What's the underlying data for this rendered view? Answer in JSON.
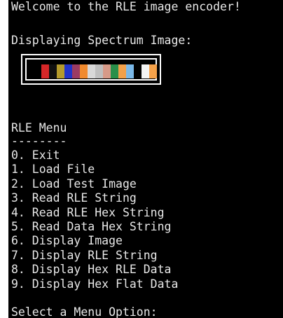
{
  "terminal": {
    "welcome": "Welcome to the RLE image encoder!",
    "displaying": "Displaying Spectrum Image:",
    "menu_title": "RLE Menu",
    "menu_rule": "--------",
    "menu_items": [
      "0. Exit",
      "1. Load File",
      "2. Load Test Image",
      "3. Read RLE String",
      "4. Read RLE Hex String",
      "5. Read Data Hex String",
      "6. Display Image",
      "7. Display RLE String",
      "8. Display Hex RLE Data",
      "9. Display Hex Flat Data"
    ],
    "prompt": "Select a Menu Option:"
  },
  "spectrum_colors": [
    "#000000",
    "#d62728",
    "#111111",
    "#b59b2b",
    "#2234c8",
    "#9b3b63",
    "#f08a2e",
    "#d8d8d8",
    "#bfbfbf",
    "#d79a88",
    "#2a8f4a",
    "#f2a04a",
    "#7ab8e8",
    "#000000",
    "#f4f4f4",
    "#f6a24a"
  ],
  "colors": {
    "background": "#000000",
    "text": "#e8e8e8"
  }
}
